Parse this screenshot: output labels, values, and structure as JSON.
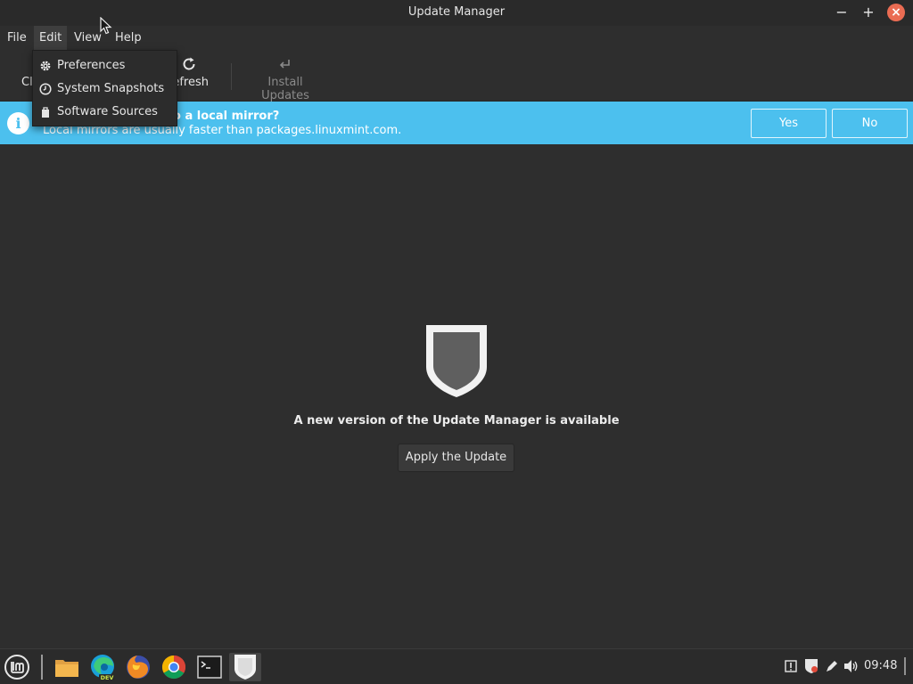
{
  "window": {
    "title": "Update Manager",
    "controls": {
      "minimize": "−",
      "maximize": "+",
      "close": "×"
    }
  },
  "menubar": {
    "items": [
      {
        "label": "File"
      },
      {
        "label": "Edit"
      },
      {
        "label": "View"
      },
      {
        "label": "Help"
      }
    ]
  },
  "toolbar": {
    "clear_label": "Cl",
    "refresh_label": "efresh",
    "install_label": "Install Updates"
  },
  "edit_menu": {
    "items": [
      {
        "label": "Preferences",
        "icon": "gear-icon"
      },
      {
        "label": "System Snapshots",
        "icon": "clock-icon"
      },
      {
        "label": "Software Sources",
        "icon": "package-icon"
      }
    ]
  },
  "infobar": {
    "title": "o a local mirror?",
    "text": "Local mirrors are usually faster than packages.linuxmint.com.",
    "yes_label": "Yes",
    "no_label": "No",
    "color": "#4cc0ee"
  },
  "main": {
    "message": "A new version of the Update Manager is available",
    "apply_label": "Apply the Update"
  },
  "taskbar": {
    "clock": "09:48",
    "edge_badge": "DEV"
  }
}
